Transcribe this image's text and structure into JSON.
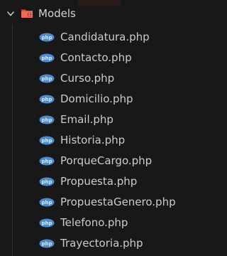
{
  "folder": {
    "name": "Models",
    "icon": "folder-models-icon",
    "expanded": true
  },
  "files": [
    {
      "name": "Candidatura.php",
      "icon": "php-elephant-icon"
    },
    {
      "name": "Contacto.php",
      "icon": "php-elephant-icon"
    },
    {
      "name": "Curso.php",
      "icon": "php-elephant-icon"
    },
    {
      "name": "Domicilio.php",
      "icon": "php-elephant-icon"
    },
    {
      "name": "Email.php",
      "icon": "php-elephant-icon"
    },
    {
      "name": "Historia.php",
      "icon": "php-elephant-icon"
    },
    {
      "name": "PorqueCargo.php",
      "icon": "php-elephant-icon"
    },
    {
      "name": "Propuesta.php",
      "icon": "php-elephant-icon"
    },
    {
      "name": "PropuestaGenero.php",
      "icon": "php-elephant-icon"
    },
    {
      "name": "Telefono.php",
      "icon": "php-elephant-icon"
    },
    {
      "name": "Trayectoria.php",
      "icon": "php-elephant-icon"
    }
  ],
  "colors": {
    "background": "#181818",
    "text": "#cccccc",
    "php_icon": "#4b8bd4",
    "folder_icon": "#e04a3a"
  }
}
